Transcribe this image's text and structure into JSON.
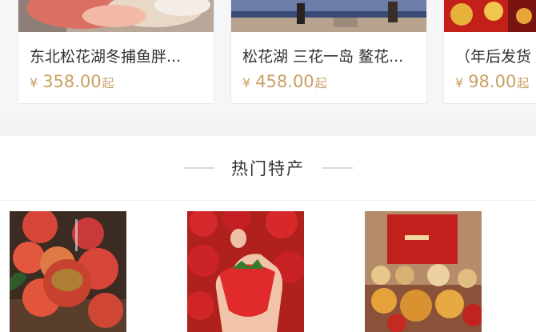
{
  "top_cards": [
    {
      "title": "东北松花湖冬捕鱼胖...",
      "price_symbol": "¥",
      "price": "358.00",
      "price_suffix": "起"
    },
    {
      "title": "松花湖 三花一岛 鳌花...",
      "price_symbol": "¥",
      "price": "458.00",
      "price_suffix": "起"
    },
    {
      "title": "（年后发货",
      "price_symbol": "¥",
      "price": "98.00",
      "price_suffix": "起"
    }
  ],
  "section": {
    "title": "热门特产"
  },
  "specialties": [
    {
      "image": "tomatoes-photo"
    },
    {
      "image": "strawberries-photo"
    },
    {
      "image": "gift-box-photo"
    }
  ],
  "colors": {
    "price": "#c9a063",
    "text": "#333333",
    "band": "#f3f3f3"
  }
}
